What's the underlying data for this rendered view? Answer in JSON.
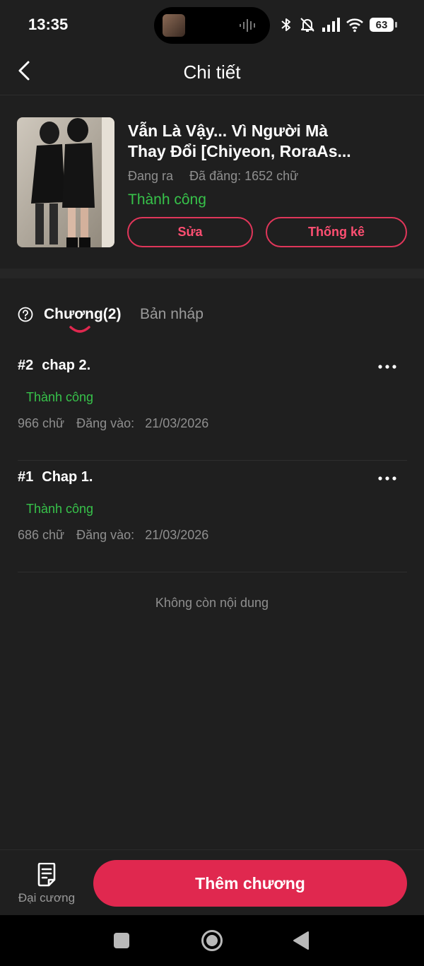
{
  "status_bar": {
    "time": "13:35",
    "battery": "63",
    "icons": [
      "bluetooth-icon",
      "bell-muted-icon",
      "signal-icon",
      "wifi-icon",
      "battery-icon"
    ]
  },
  "header": {
    "title": "Chi tiết",
    "back_icon": "chevron-left-icon"
  },
  "story": {
    "title_line1": "Vẫn Là Vậy... Vì Người Mà",
    "title_line2": "Thay Đổi [Chiyeon, RoraAs...",
    "state": "Đang ra",
    "word_count": "Đã đăng: 1652 chữ",
    "status": "Thành công",
    "edit_label": "Sửa",
    "stats_label": "Thống kê"
  },
  "tabs": {
    "chapters_label": "Chương(2)",
    "drafts_label": "Bản nháp",
    "active": "chapters"
  },
  "chapters": [
    {
      "number": "#2",
      "title": "chap 2.",
      "status": "Thành công",
      "words": "966 chữ",
      "posted_label": "Đăng vào:",
      "date": "21/03/2026"
    },
    {
      "number": "#1",
      "title": "Chap 1.",
      "status": "Thành công",
      "words": "686 chữ",
      "posted_label": "Đăng vào:",
      "date": "21/03/2026"
    }
  ],
  "empty_message": "Không còn nội dung",
  "bottom": {
    "outline_label": "Đại cương",
    "add_chapter_label": "Thêm chương"
  },
  "colors": {
    "accent": "#e0284f",
    "success": "#37c24a",
    "background": "#1f1f1f",
    "muted_text": "#8f8f8f"
  }
}
